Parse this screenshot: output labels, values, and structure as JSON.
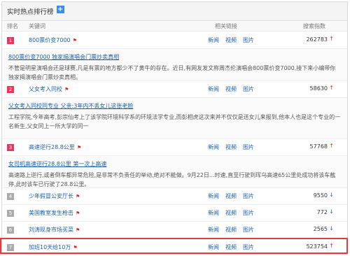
{
  "header": {
    "title": "实时热点排行榜",
    "add_icon": "plus-square-icon"
  },
  "columns": {
    "rank": "排名",
    "keyword": "关键词",
    "links": "相关链接",
    "index": "搜索指数"
  },
  "colors": {
    "rank_hot": "#e8365f",
    "rank_normal": "#aaaaaa",
    "up": "#e02828",
    "down": "#2d6bd3",
    "accent": "#3a8ee6"
  },
  "rows": [
    {
      "rank": "1",
      "keyword": "800票价变7000",
      "links": [
        "新闻",
        "视频",
        "图片"
      ],
      "index": "262783",
      "trend": "↑"
    },
    {
      "rank": "2",
      "keyword": "父女考入同校",
      "links": [
        "新闻",
        "视频",
        "图片"
      ],
      "index": "58630",
      "trend": "↑"
    },
    {
      "rank": "3",
      "keyword": "高速逆行28.8公里",
      "links": [
        "新闻",
        "视频",
        "图片"
      ],
      "index": "57768",
      "trend": "↑"
    },
    {
      "rank": "4",
      "keyword": "少年假冒公安厅长",
      "links": [
        "新闻",
        "视频",
        "图片"
      ],
      "index": "9550",
      "trend": "↓"
    },
    {
      "rank": "5",
      "keyword": "美国教室发生枪击",
      "links": [
        "新闻",
        "视频",
        "图片"
      ],
      "index": "772",
      "trend": "↓"
    },
    {
      "rank": "6",
      "keyword": "刘涛现身市场买菜",
      "links": [
        "新闻",
        "视频",
        "图片"
      ],
      "index": "2565",
      "trend": "↓"
    },
    {
      "rank": "7",
      "keyword": "加班10天给10万",
      "links": [
        "新闻",
        "视频",
        "图片"
      ],
      "index": "523754",
      "trend": "↑"
    }
  ],
  "details": [
    {
      "title": "800票价变7000 独家揭演唱会门票炒卖真相",
      "text": "不管是明星演唱会还是球赛,凡是有票的地方都少不了黄牛的存在。近日,有网友发文称周杰伦演唱会800票价变7000,接下来小编带你独家揭演唱会门票炒卖真相。"
    },
    {
      "title": "父女考入同校同专业 父亲:3年内不丢女儿这张老脸",
      "text": "工程学院,今年高考,彭宗仙考上了该学院环境科学系的环境法学专业,而彭相虎这次来并不仅仅是送女儿来报到,他本人也是这个专业的一名新生,父女同上一所大学的同一"
    },
    {
      "title": "女司机高速逆行28.8公里 第一次上高速",
      "text": "高速路上逆行,或者倒车都异常危险,是非常不负责任的举动,绝对不能做。9月22日...时速,直至行驶到珲乌高速65公里处成功将该车截停,此时该车已行驶了28.8公里。"
    }
  ]
}
